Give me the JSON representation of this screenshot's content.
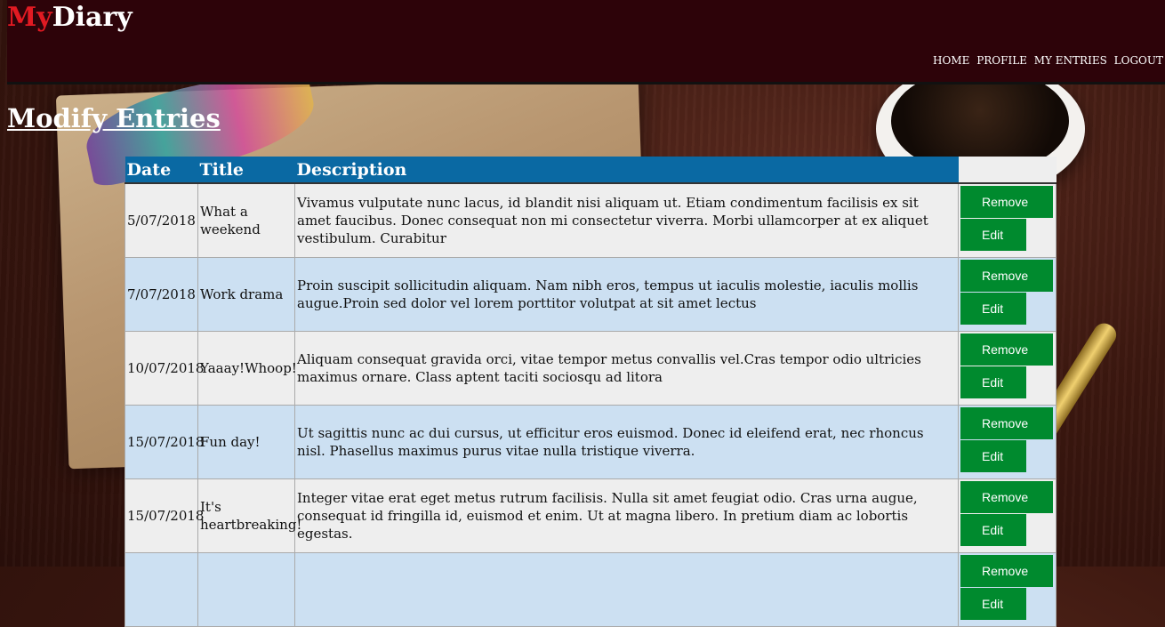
{
  "header": {
    "logo_prefix": "My",
    "logo_suffix": "Diary",
    "nav": [
      "HOME",
      "PROFILE",
      "MY ENTRIES",
      "LOGOUT"
    ]
  },
  "page": {
    "title": "Modify Entries"
  },
  "table": {
    "columns": [
      "Date",
      "Title",
      "Description",
      ""
    ],
    "rows": [
      {
        "date": "5/07/2018",
        "title": "What a weekend",
        "description": "Vivamus vulputate nunc lacus, id blandit nisi aliquam ut. Etiam condimentum facilisis ex sit amet faucibus. Donec consequat non mi consectetur viverra. Morbi ullamcorper at ex aliquet vestibulum. Curabitur"
      },
      {
        "date": "7/07/2018",
        "title": "Work drama",
        "description": "Proin suscipit sollicitudin aliquam. Nam nibh eros, tempus ut iaculis molestie, iaculis mollis augue.Proin sed dolor vel lorem porttitor volutpat at sit amet lectus"
      },
      {
        "date": "10/07/2018",
        "title": "Yaaay!Whoop!",
        "description": "Aliquam consequat gravida orci, vitae tempor metus convallis vel.Cras tempor odio ultricies maximus ornare. Class aptent taciti sociosqu ad litora"
      },
      {
        "date": "15/07/2018",
        "title": "Fun day!",
        "description": "Ut sagittis nunc ac dui cursus, ut efficitur eros euismod. Donec id eleifend erat, nec rhoncus nisl. Phasellus maximus purus vitae nulla tristique viverra."
      },
      {
        "date": "15/07/2018",
        "title": "It's heartbreaking!",
        "description": "Integer vitae erat eget metus rutrum facilisis. Nulla sit amet feugiat odio. Cras urna augue, consequat id fringilla id, euismod et enim. Ut at magna libero. In pretium diam ac lobortis egestas."
      },
      {
        "date": "",
        "title": "",
        "description": ""
      }
    ],
    "remove_label": "Remove",
    "edit_label": "Edit"
  },
  "colors": {
    "header_bg": "#2d0309",
    "logo_accent": "#e11a22",
    "table_header": "#0a69a3",
    "row_odd": "#eeeeee",
    "row_even": "#cce0f2",
    "button": "#008a2e"
  }
}
